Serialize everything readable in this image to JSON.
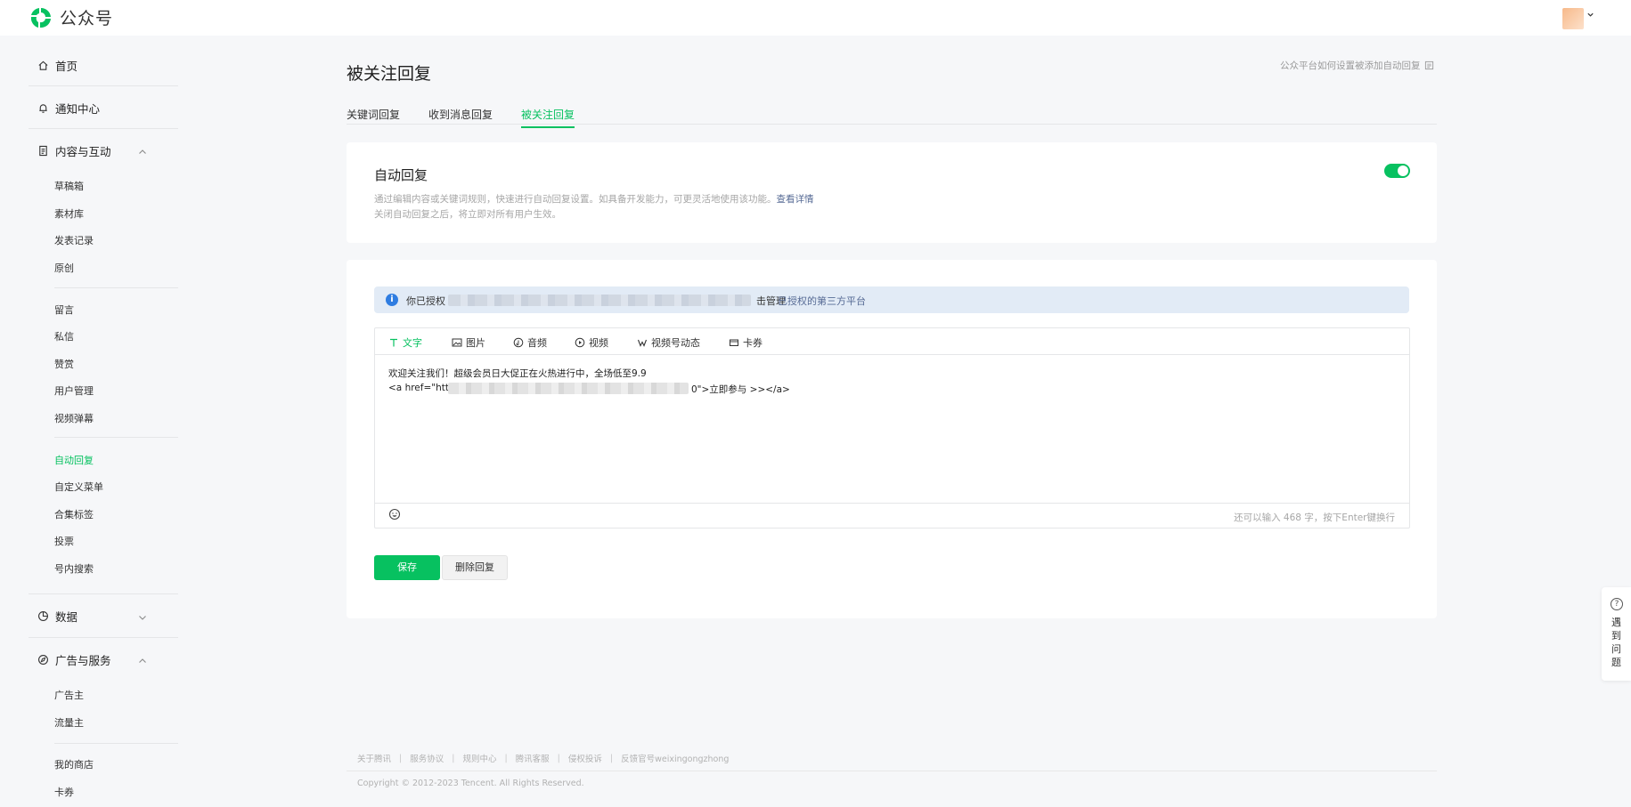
{
  "app": {
    "name": "公众号"
  },
  "header": {
    "avatar_label": ""
  },
  "sidebar": {
    "home": "首页",
    "notifications": "通知中心",
    "content_group": "内容与互动",
    "content_items": [
      "草稿箱",
      "素材库",
      "发表记录",
      "原创"
    ],
    "interaction_items": [
      "留言",
      "私信",
      "赞赏",
      "用户管理",
      "视频弹幕"
    ],
    "function_items": [
      "自动回复",
      "自定义菜单",
      "合集标签",
      "投票",
      "号内搜索"
    ],
    "data_group": "数据",
    "ads_group": "广告与服务",
    "ads_items": [
      "广告主",
      "流量主"
    ],
    "shop_items": [
      "我的商店",
      "卡券"
    ],
    "active_item": "自动回复"
  },
  "page": {
    "title": "被关注回复",
    "help_link": "公众平台如何设置被添加自动回复",
    "tabs": [
      "关键词回复",
      "收到消息回复",
      "被关注回复"
    ],
    "active_tab": "被关注回复"
  },
  "auto_reply": {
    "title": "自动回复",
    "desc1": "通过编辑内容或关键词规则，快速进行自动回复设置。如具备开发能力，可更灵活地使用该功能。",
    "desc1_link": "查看详情",
    "desc2": "关闭自动回复之后，将立即对所有用户生效。",
    "enabled": true
  },
  "notice": {
    "prefix": "你已授权",
    "middle": "击管理",
    "link": "已授权的第三方平台"
  },
  "editor": {
    "tabs": [
      "文字",
      "图片",
      "音频",
      "视频",
      "视频号动态",
      "卡券"
    ],
    "active_tab": "文字",
    "line1": "欢迎关注我们！超级会员日大促正在火热进行中，全场低至9.9",
    "line2_prefix": "<a href=\"http",
    "line2_suffix": "0\">立即参与 >></a>",
    "counter": "还可以输入 468 字，按下Enter键换行"
  },
  "actions": {
    "save": "保存",
    "delete": "删除回复"
  },
  "footer": {
    "links": [
      "关于腾讯",
      "服务协议",
      "规则中心",
      "腾讯客服",
      "侵权投诉",
      "反馈官号weixingongzhong"
    ],
    "copyright": "Copyright © 2012-2023 Tencent. All Rights Reserved."
  },
  "help_float": {
    "label": "遇到问题"
  },
  "colors": {
    "accent": "#07c160",
    "link": "#576b95",
    "notice_bg": "#e2ebf6",
    "info": "#2f7de1"
  }
}
